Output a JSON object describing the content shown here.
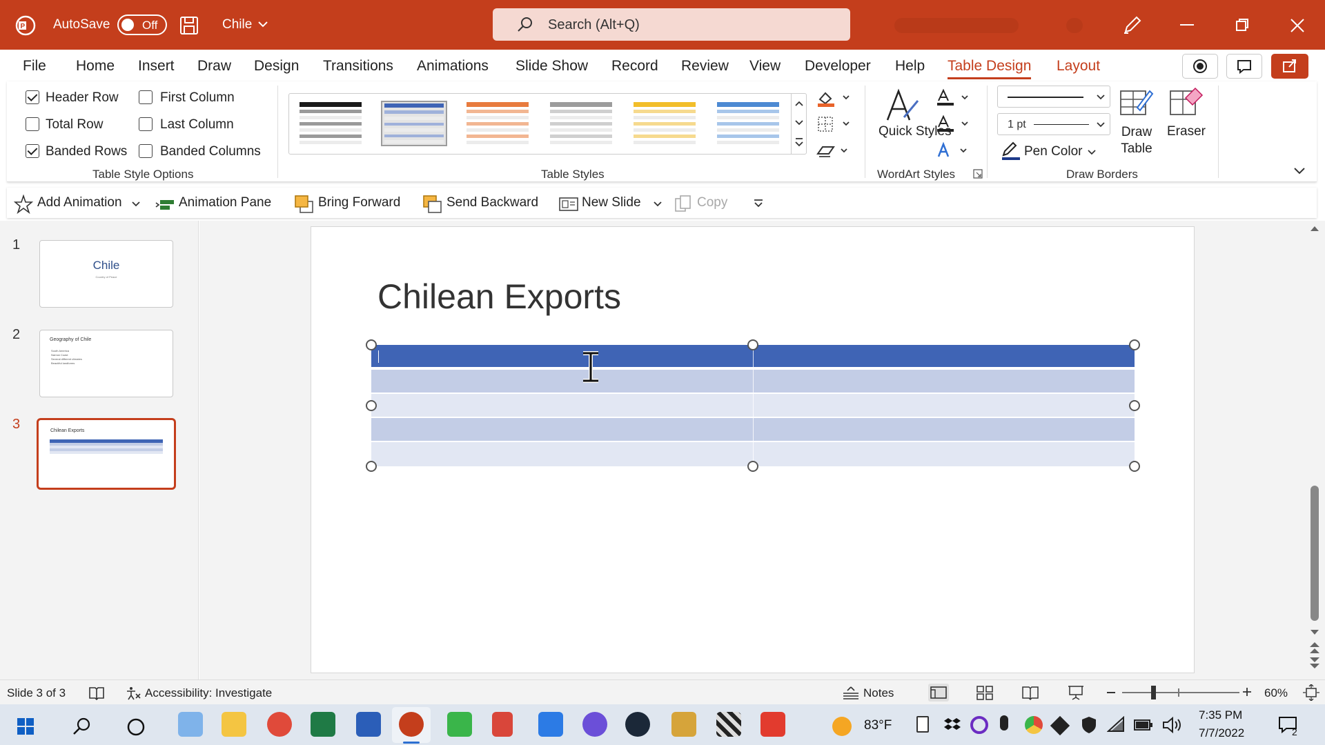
{
  "titlebar": {
    "autosave_label": "AutoSave",
    "autosave_state": "Off",
    "file_name": "Chile",
    "search_placeholder": "Search (Alt+Q)",
    "accent": "#c43e1c"
  },
  "menu": {
    "items": [
      "File",
      "Home",
      "Insert",
      "Draw",
      "Design",
      "Transitions",
      "Animations",
      "Slide Show",
      "Record",
      "Review",
      "View",
      "Developer",
      "Help",
      "Table Design",
      "Layout"
    ],
    "active": "Table Design"
  },
  "ribbon": {
    "table_style_options": {
      "header_row": "Header Row",
      "total_row": "Total Row",
      "banded_rows": "Banded Rows",
      "first_column": "First Column",
      "last_column": "Last Column",
      "banded_columns": "Banded Columns",
      "group_label": "Table Style Options",
      "checked": {
        "header_row": true,
        "total_row": false,
        "banded_rows": true,
        "first_column": false,
        "last_column": false,
        "banded_columns": false
      }
    },
    "table_styles": {
      "group_label": "Table Styles",
      "styles": [
        {
          "header": "#1a1a1a",
          "band": "#9a9a9a",
          "name": "black"
        },
        {
          "header": "#3f64b5",
          "band": "#9fb1da",
          "name": "blue-selected"
        },
        {
          "header": "#e87b3e",
          "band": "#f2b692",
          "name": "orange"
        },
        {
          "header": "#9c9c9c",
          "band": "#cfcfcf",
          "name": "gray"
        },
        {
          "header": "#f2be2a",
          "band": "#f6da8e",
          "name": "gold"
        },
        {
          "header": "#4d8ad3",
          "band": "#a7c6ea",
          "name": "light-blue"
        }
      ]
    },
    "wordart": {
      "quick_styles": "Quick Styles",
      "group_label": "WordArt Styles"
    },
    "draw_borders": {
      "pen_weight": "1 pt",
      "pen_color": "Pen Color",
      "draw_table": "Draw Table",
      "eraser": "Eraser",
      "group_label": "Draw Borders"
    }
  },
  "qat": {
    "add_animation": "Add Animation",
    "animation_pane": "Animation Pane",
    "bring_forward": "Bring Forward",
    "send_backward": "Send Backward",
    "new_slide": "New Slide",
    "copy": "Copy"
  },
  "slides": [
    {
      "num": "1",
      "title": "Chile",
      "subtitle": "Country of Peace"
    },
    {
      "num": "2",
      "title": "Geography of Chile",
      "bullets": [
        "South America",
        "Narrow Coast",
        "Several different climates",
        "Beautiful landforms"
      ]
    },
    {
      "num": "3",
      "title": "Chilean Exports"
    }
  ],
  "current_slide": {
    "title": "Chilean Exports",
    "table": {
      "columns": 2,
      "rows": 5,
      "header_color": "#3f64b5",
      "band_dark": "#c3cde6",
      "band_light": "#e2e7f3"
    }
  },
  "status": {
    "slide_info": "Slide 3 of 3",
    "accessibility": "Accessibility: Investigate",
    "notes": "Notes",
    "zoom": "60%"
  },
  "taskbar": {
    "weather": "83°F",
    "time": "7:35 PM",
    "date": "7/7/2022",
    "notification_count": "2"
  }
}
